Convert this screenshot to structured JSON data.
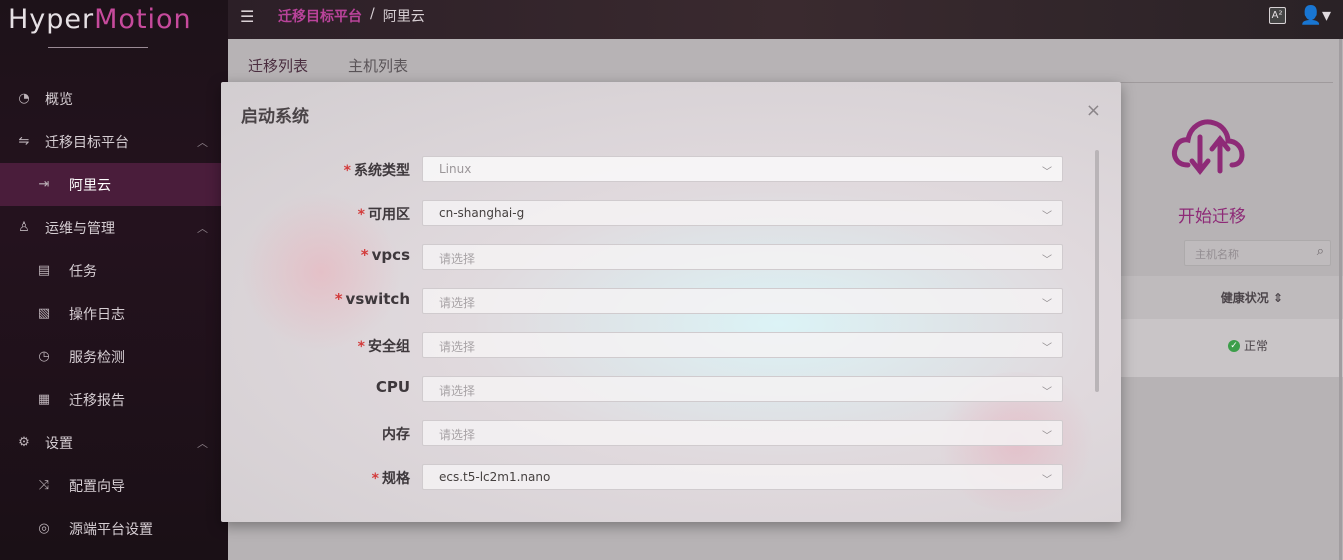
{
  "sidebar": {
    "logo_part1": "Hyper",
    "logo_part2": "Motion",
    "items": [
      {
        "label": "概览"
      },
      {
        "label": "迁移目标平台"
      },
      {
        "label": "阿里云"
      },
      {
        "label": "运维与管理"
      },
      {
        "label": "任务"
      },
      {
        "label": "操作日志"
      },
      {
        "label": "服务检测"
      },
      {
        "label": "迁移报告"
      },
      {
        "label": "设置"
      },
      {
        "label": "配置向导"
      },
      {
        "label": "源端平台设置"
      }
    ]
  },
  "topbar": {
    "breadcrumb": [
      "迁移目标平台",
      "/",
      "阿里云"
    ],
    "lang_icon": "A²"
  },
  "main": {
    "tabs": [
      "迁移列表",
      "主机列表"
    ],
    "start_label": "开始迁移",
    "search_placeholder": "主机名称",
    "health_header": "健康状况 ⇕",
    "health_value": "正常"
  },
  "modal": {
    "title": "启动系统",
    "close": "×",
    "fields": [
      {
        "label": "系统类型",
        "required": "*",
        "value": "Linux"
      },
      {
        "label": "可用区",
        "required": "*",
        "value": "cn-shanghai-g"
      },
      {
        "label": "vpcs",
        "required": "*",
        "value": "请选择"
      },
      {
        "label": "vswitch",
        "required": "*",
        "value": "请选择"
      },
      {
        "label": "安全组",
        "required": "*",
        "value": "请选择"
      },
      {
        "label": "CPU",
        "required": "",
        "value": "请选择"
      },
      {
        "label": "内存",
        "required": "",
        "value": "请选择"
      },
      {
        "label": "规格",
        "required": "*",
        "value": "ecs.t5-lc2m1.nano"
      }
    ]
  },
  "colors": {
    "accent": "#b9439a",
    "sidebar_active": "#4a1d3b",
    "required": "#d33b3b"
  }
}
